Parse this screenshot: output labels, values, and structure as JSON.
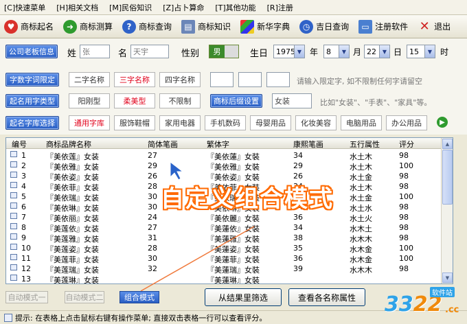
{
  "menu": [
    "[C]快速菜单",
    "[H]相关文档",
    "[M]民俗知识",
    "[Z]占卜算命",
    "[T]其他功能",
    "[R]注册"
  ],
  "toolbar": [
    {
      "label": "商标起名",
      "icon": "heart-icon",
      "color": "#d9312b"
    },
    {
      "label": "商标测算",
      "icon": "arrow-right-icon",
      "color": "#2f9b2f"
    },
    {
      "label": "商标查询",
      "icon": "help-icon",
      "color": "#2f62c8"
    },
    {
      "label": "商标知识",
      "icon": "document-icon",
      "color": "#6b86b8"
    },
    {
      "label": "新华字典",
      "icon": "windows-icon",
      "color": "#e06a16"
    },
    {
      "label": "吉日查询",
      "icon": "clock-icon",
      "color": "#2f62c8"
    },
    {
      "label": "注册软件",
      "icon": "monitor-icon",
      "color": "#4a7fd0"
    },
    {
      "label": "退出",
      "icon": "close-icon",
      "color": "#cf2222"
    }
  ],
  "owner": {
    "button": "公司老板信息",
    "surname_label": "姓",
    "surname_value": "张",
    "name_label": "名",
    "name_value": "天宇",
    "gender_label": "性别",
    "gender_value": "男",
    "birth_label": "生日",
    "year": "1975",
    "year_unit": "年",
    "month": "8",
    "month_unit": "月",
    "day": "22",
    "day_unit": "日",
    "hour": "15",
    "hour_unit": "时"
  },
  "limit": {
    "button": "字数字词限定",
    "options": [
      "二字名称",
      "三字名称",
      "四字名称"
    ],
    "selected": "三字名称",
    "hint": "请输入限定字, 如不限制任何字请留空"
  },
  "type": {
    "button": "起名用字类型",
    "options": [
      "阳刚型",
      "柔美型",
      "不限制"
    ],
    "selected": "柔美型",
    "suffix_button": "商标后缀设置",
    "suffix_value": "女装",
    "hint": "比如\"女装\"、\"手表\"、\"家具\"等。"
  },
  "library": {
    "button": "起名字库选择",
    "options": [
      "通用字库",
      "服饰鞋帽",
      "家用电器",
      "手机数码",
      "母婴用品",
      "化妆美容",
      "电脑用品",
      "办公用品"
    ],
    "selected": "通用字库"
  },
  "table": {
    "columns": [
      "编号",
      "商标品牌名称",
      "简体笔画",
      "繁体字",
      "康熙笔画",
      "五行属性",
      "评分"
    ],
    "rows": [
      [
        "1",
        "『美依莲』女装",
        "27",
        "『美依蓮』女裝",
        "34",
        "水土木",
        "98"
      ],
      [
        "2",
        "『美依雅』女装",
        "29",
        "『美依雅』女裝",
        "29",
        "水土木",
        "100"
      ],
      [
        "3",
        "『美依姿』女装",
        "26",
        "『美依姿』女裝",
        "26",
        "水土金",
        "98"
      ],
      [
        "4",
        "『美依菲』女装",
        "28",
        "『美依菲』女裝",
        "34",
        "水土木",
        "98"
      ],
      [
        "5",
        "『美依瑞』女装",
        "30",
        "『美依瑞』女裝",
        "33",
        "水土金",
        "100"
      ],
      [
        "6",
        "『美依琳』女装",
        "30",
        "『美依琳』女裝",
        "34",
        "水土水",
        "98"
      ],
      [
        "7",
        "『美依丽』女装",
        "24",
        "『美依麗』女裝",
        "36",
        "水土火",
        "98"
      ],
      [
        "8",
        "『美莲依』女装",
        "27",
        "『美蓮依』女裝",
        "34",
        "水木土",
        "98"
      ],
      [
        "9",
        "『美莲雅』女装",
        "31",
        "『美蓮雅』女裝",
        "38",
        "水木木",
        "98"
      ],
      [
        "10",
        "『美莲姿』女装",
        "28",
        "『美蓮姿』女裝",
        "35",
        "水木金",
        "100"
      ],
      [
        "11",
        "『美莲菲』女装",
        "30",
        "『美蓮菲』女裝",
        "36",
        "水木金",
        "100"
      ],
      [
        "12",
        "『美莲瑞』女装",
        "32",
        "『美蓮瑞』女裝",
        "39",
        "水木木",
        "98"
      ],
      [
        "13",
        "『美莲琳』女装",
        "",
        "『美蓮琳』女裝",
        "",
        "",
        ""
      ]
    ]
  },
  "overlay_text": "自定义组合模式",
  "modes": [
    "自动模式一",
    "自动模式二",
    "组合模式"
  ],
  "active_mode": "组合模式",
  "actions": [
    "从结果里筛选",
    "查看各名称属性"
  ],
  "status": "提示: 在表格上点击鼠标右键有操作菜单; 直接双击表格一行可以查看评分。",
  "watermark": {
    "number_a": "33",
    "number_b": "22",
    "domain": ".cc",
    "tag": "软件站"
  }
}
